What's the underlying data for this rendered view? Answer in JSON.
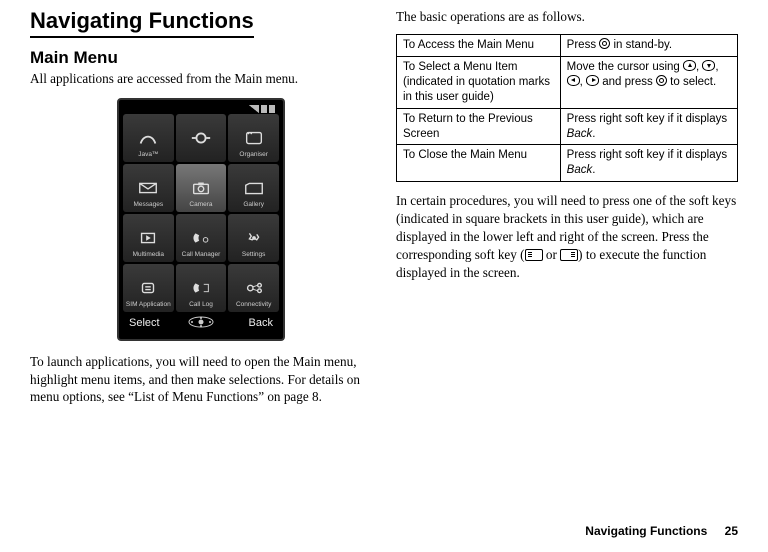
{
  "left": {
    "h1": "Navigating Functions",
    "h2": "Main Menu",
    "intro": "All applications are accessed from the Main menu.",
    "p2": "To launch applications, you will need to open the Main menu, highlight menu items, and then make selections. For details on menu options, see “List of Menu Functions” on page 8."
  },
  "phone": {
    "apps": [
      "Java™",
      " ",
      "Organiser",
      "Messages",
      "Camera",
      "Gallery",
      "Multimedia",
      "Call Manager",
      "Settings",
      "SIM Application",
      "Call Log",
      "Connectivity"
    ],
    "soft_left": "Select",
    "soft_right": "Back"
  },
  "right": {
    "lead": "The basic operations are as follows.",
    "table": [
      {
        "l": "To Access the Main Menu",
        "r_pre": "Press ",
        "r_post": " in stand-by.",
        "mode": "circ"
      },
      {
        "l": "To Select a Menu Item (indicated in quotation marks in this user guide)",
        "r_pre": "Move the cursor using ",
        "r_mid": " and press ",
        "r_post": " to select.",
        "mode": "arrows"
      },
      {
        "l": "To Return to the Previous Screen",
        "r_pre": "Press right soft key if it displays ",
        "r_it": "Back",
        "r_post": ".",
        "mode": "it"
      },
      {
        "l": "To Close the Main Menu",
        "r_pre": "Press right soft key if it displays ",
        "r_it": "Back",
        "r_post": ".",
        "mode": "it"
      }
    ],
    "p_after_pre": "In certain procedures, you will need to press one of the soft keys (indicated in square brackets in this user guide), which are displayed in the lower left and right of the screen. Press the corresponding soft key (",
    "p_after_mid": " or ",
    "p_after_post": ") to execute the function displayed in the screen."
  },
  "footer": {
    "title": "Navigating Functions",
    "page": "25"
  }
}
